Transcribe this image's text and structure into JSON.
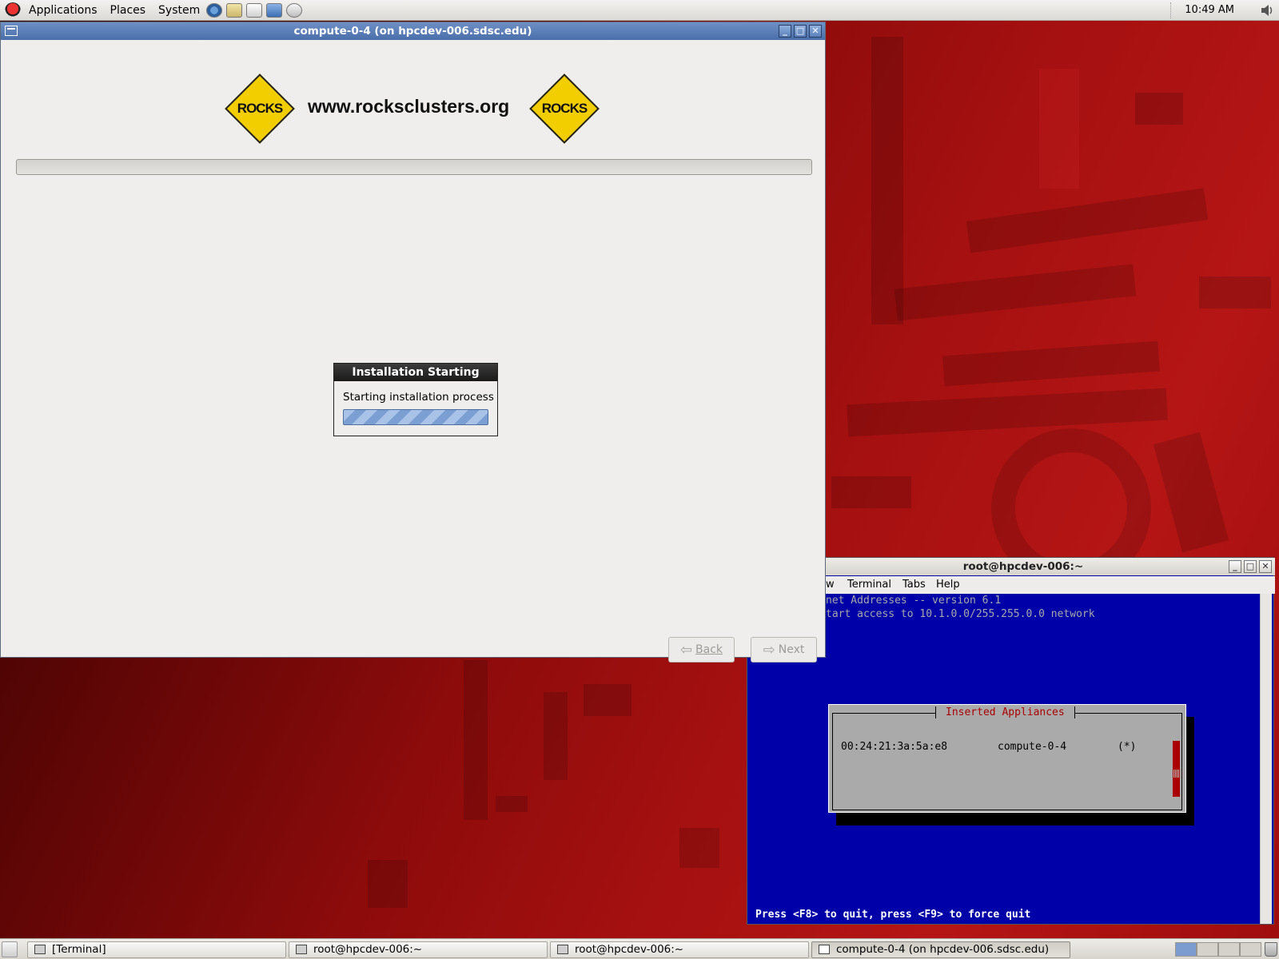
{
  "top_panel": {
    "menus": [
      "Applications",
      "Places",
      "System"
    ],
    "launchers": [
      "web-browser-icon",
      "email-icon",
      "text-editor-icon",
      "presentation-icon",
      "help-icon"
    ],
    "clock": "10:49 AM"
  },
  "installer_window": {
    "title": "compute-0-4 (on hpcdev-006.sdsc.edu)",
    "logo_text": "ROCKS",
    "url": "www.rocksclusters.org",
    "main_progress_fraction": 0,
    "back_label": "Back",
    "next_label": "Next"
  },
  "dialog": {
    "title": "Installation Starting",
    "message": "Starting installation process",
    "progress": "indeterminate"
  },
  "terminal_window": {
    "title": "root@hpcdev-006:~",
    "menus": [
      "w",
      "Terminal",
      "Tabs",
      "Help"
    ],
    "lines": [
      "net Addresses -- version 6.1",
      "tart access to 10.1.0.0/255.255.0.0 network"
    ],
    "appliances_box": {
      "title": "Inserted Appliances",
      "mac": "00:24:21:3a:5a:e8",
      "name": "compute-0-4",
      "mark": "(*)"
    },
    "footer": "Press <F8> to quit, press <F9> to force quit"
  },
  "taskbar": {
    "tasks": [
      "[Terminal]",
      "root@hpcdev-006:~",
      "root@hpcdev-006:~",
      "compute-0-4 (on hpcdev-006.sdsc.edu)"
    ],
    "active_task": 3,
    "workspaces": 4,
    "current_workspace": 1
  },
  "colors": {
    "desktop": "#a51010",
    "terminal_bg": "#0000a8",
    "rocks_yellow": "#f2cd00",
    "dialog_title_bg": "#1a1a1a",
    "window_title_active": "#4a6ea9"
  }
}
